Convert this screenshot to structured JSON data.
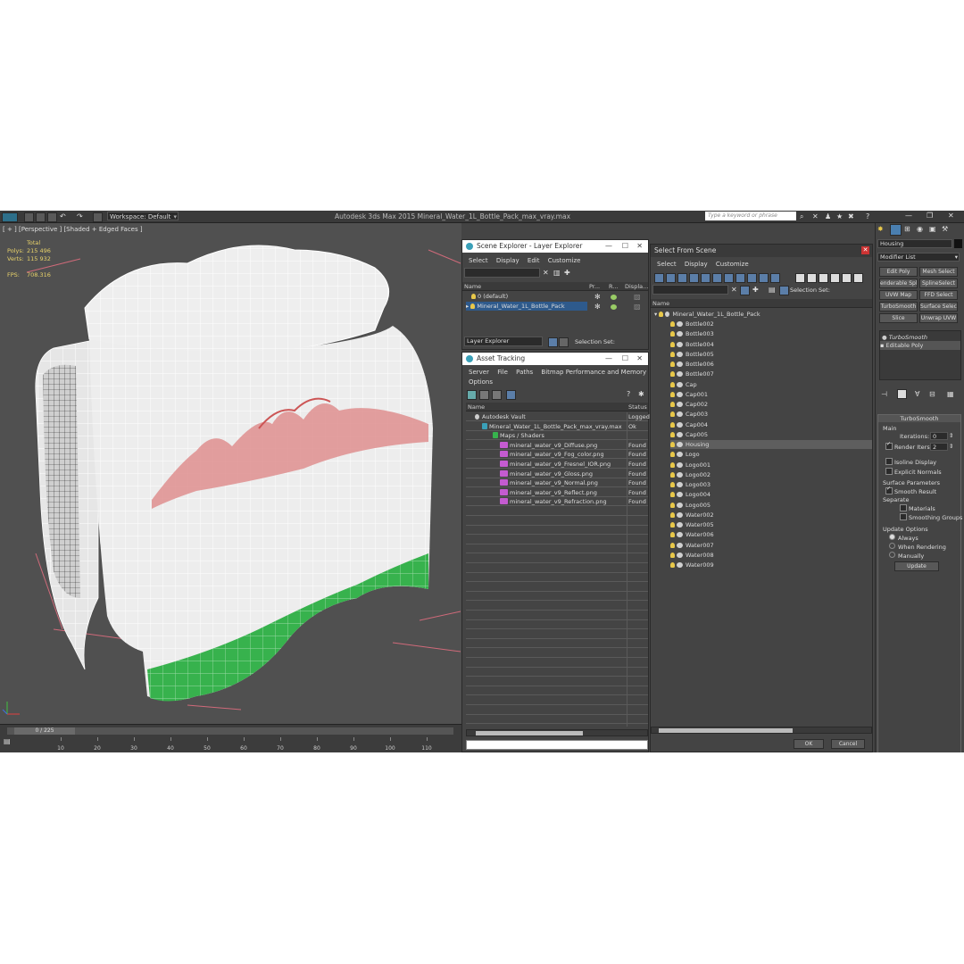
{
  "app": {
    "title": "Autodesk 3ds Max  2015     Mineral_Water_1L_Bottle_Pack_max_vray.max",
    "workspace": "Workspace: Default",
    "search_placeholder": "Type a keyword or phrase"
  },
  "viewport": {
    "label": "[ + ] [Perspective ] [Shaded + Edged Faces ]",
    "stats": {
      "total": "Total",
      "polys_label": "Polys:",
      "polys": "215 496",
      "verts_label": "Verts:",
      "verts": "115 932",
      "fps_label": "FPS:",
      "fps": "708.316"
    }
  },
  "timeline": {
    "frame": "0 / 225",
    "ticks": [
      "10",
      "20",
      "30",
      "40",
      "50",
      "60",
      "70",
      "80",
      "90",
      "100",
      "110"
    ]
  },
  "scene_explorer": {
    "title": "Scene Explorer - Layer Explorer",
    "menu": [
      "Select",
      "Display",
      "Edit",
      "Customize"
    ],
    "columns": [
      "Name",
      "Pr...",
      "R...",
      "Displa..."
    ],
    "rows": [
      "0 (default)",
      "Mineral_Water_1L_Bottle_Pack"
    ],
    "footer_label": "Layer Explorer",
    "selection_set": "Selection Set:"
  },
  "asset_tracking": {
    "title": "Asset Tracking",
    "menu": [
      "Server",
      "File",
      "Paths",
      "Bitmap Performance and Memory"
    ],
    "menu2": "Options",
    "columns": [
      "Name",
      "Status"
    ],
    "rows": [
      {
        "name": "Autodesk Vault",
        "status": "Logged"
      },
      {
        "name": "Mineral_Water_1L_Bottle_Pack_max_vray.max",
        "status": "Ok"
      },
      {
        "name": "Maps / Shaders",
        "status": ""
      },
      {
        "name": "mineral_water_v9_Diffuse.png",
        "status": "Found"
      },
      {
        "name": "mineral_water_v9_Fog_color.png",
        "status": "Found"
      },
      {
        "name": "mineral_water_v9_Fresnel_IOR.png",
        "status": "Found"
      },
      {
        "name": "mineral_water_v9_Gloss.png",
        "status": "Found"
      },
      {
        "name": "mineral_water_v9_Normal.png",
        "status": "Found"
      },
      {
        "name": "mineral_water_v9_Reflect.png",
        "status": "Found"
      },
      {
        "name": "mineral_water_v9_Refraction.png",
        "status": "Found"
      }
    ]
  },
  "select_from_scene": {
    "title": "Select From Scene",
    "menu": [
      "Select",
      "Display",
      "Customize"
    ],
    "selection_set": "Selection Set:",
    "column": "Name",
    "root": "Mineral_Water_1L_Bottle_Pack",
    "items": [
      "Bottle002",
      "Bottle003",
      "Bottle004",
      "Bottle005",
      "Bottle006",
      "Bottle007",
      "Cap",
      "Cap001",
      "Cap002",
      "Cap003",
      "Cap004",
      "Cap005",
      "Housing",
      "Logo",
      "Logo001",
      "Logo002",
      "Logo003",
      "Logo004",
      "Logo005",
      "Water002",
      "Water005",
      "Water006",
      "Water007",
      "Water008",
      "Water009"
    ],
    "ok": "OK",
    "cancel": "Cancel"
  },
  "command_panel": {
    "object_name": "Housing",
    "modifier_list": "Modifier List",
    "buttons": [
      "Edit Poly",
      "Mesh Select",
      "enderable Spli",
      "SplineSelect",
      "UVW Map",
      "FFD Select",
      "TurboSmooth",
      "Surface Select",
      "Slice",
      "Unwrap UVW"
    ],
    "stack": [
      "TurboSmooth",
      "Editable Poly"
    ],
    "rollout_title": "TurboSmooth",
    "main": "Main",
    "iterations_label": "Iterations:",
    "iterations": "0",
    "render_iters_label": "Render Iters:",
    "render_iters": "2",
    "isoline": "Isoline Display",
    "explicit": "Explicit Normals",
    "surface_params": "Surface Parameters",
    "smooth_result": "Smooth Result",
    "separate": "Separate",
    "materials": "Materials",
    "smoothing_groups": "Smoothing Groups",
    "update_options": "Update Options",
    "always": "Always",
    "when_rendering": "When Rendering",
    "manually": "Manually",
    "update": "Update"
  }
}
